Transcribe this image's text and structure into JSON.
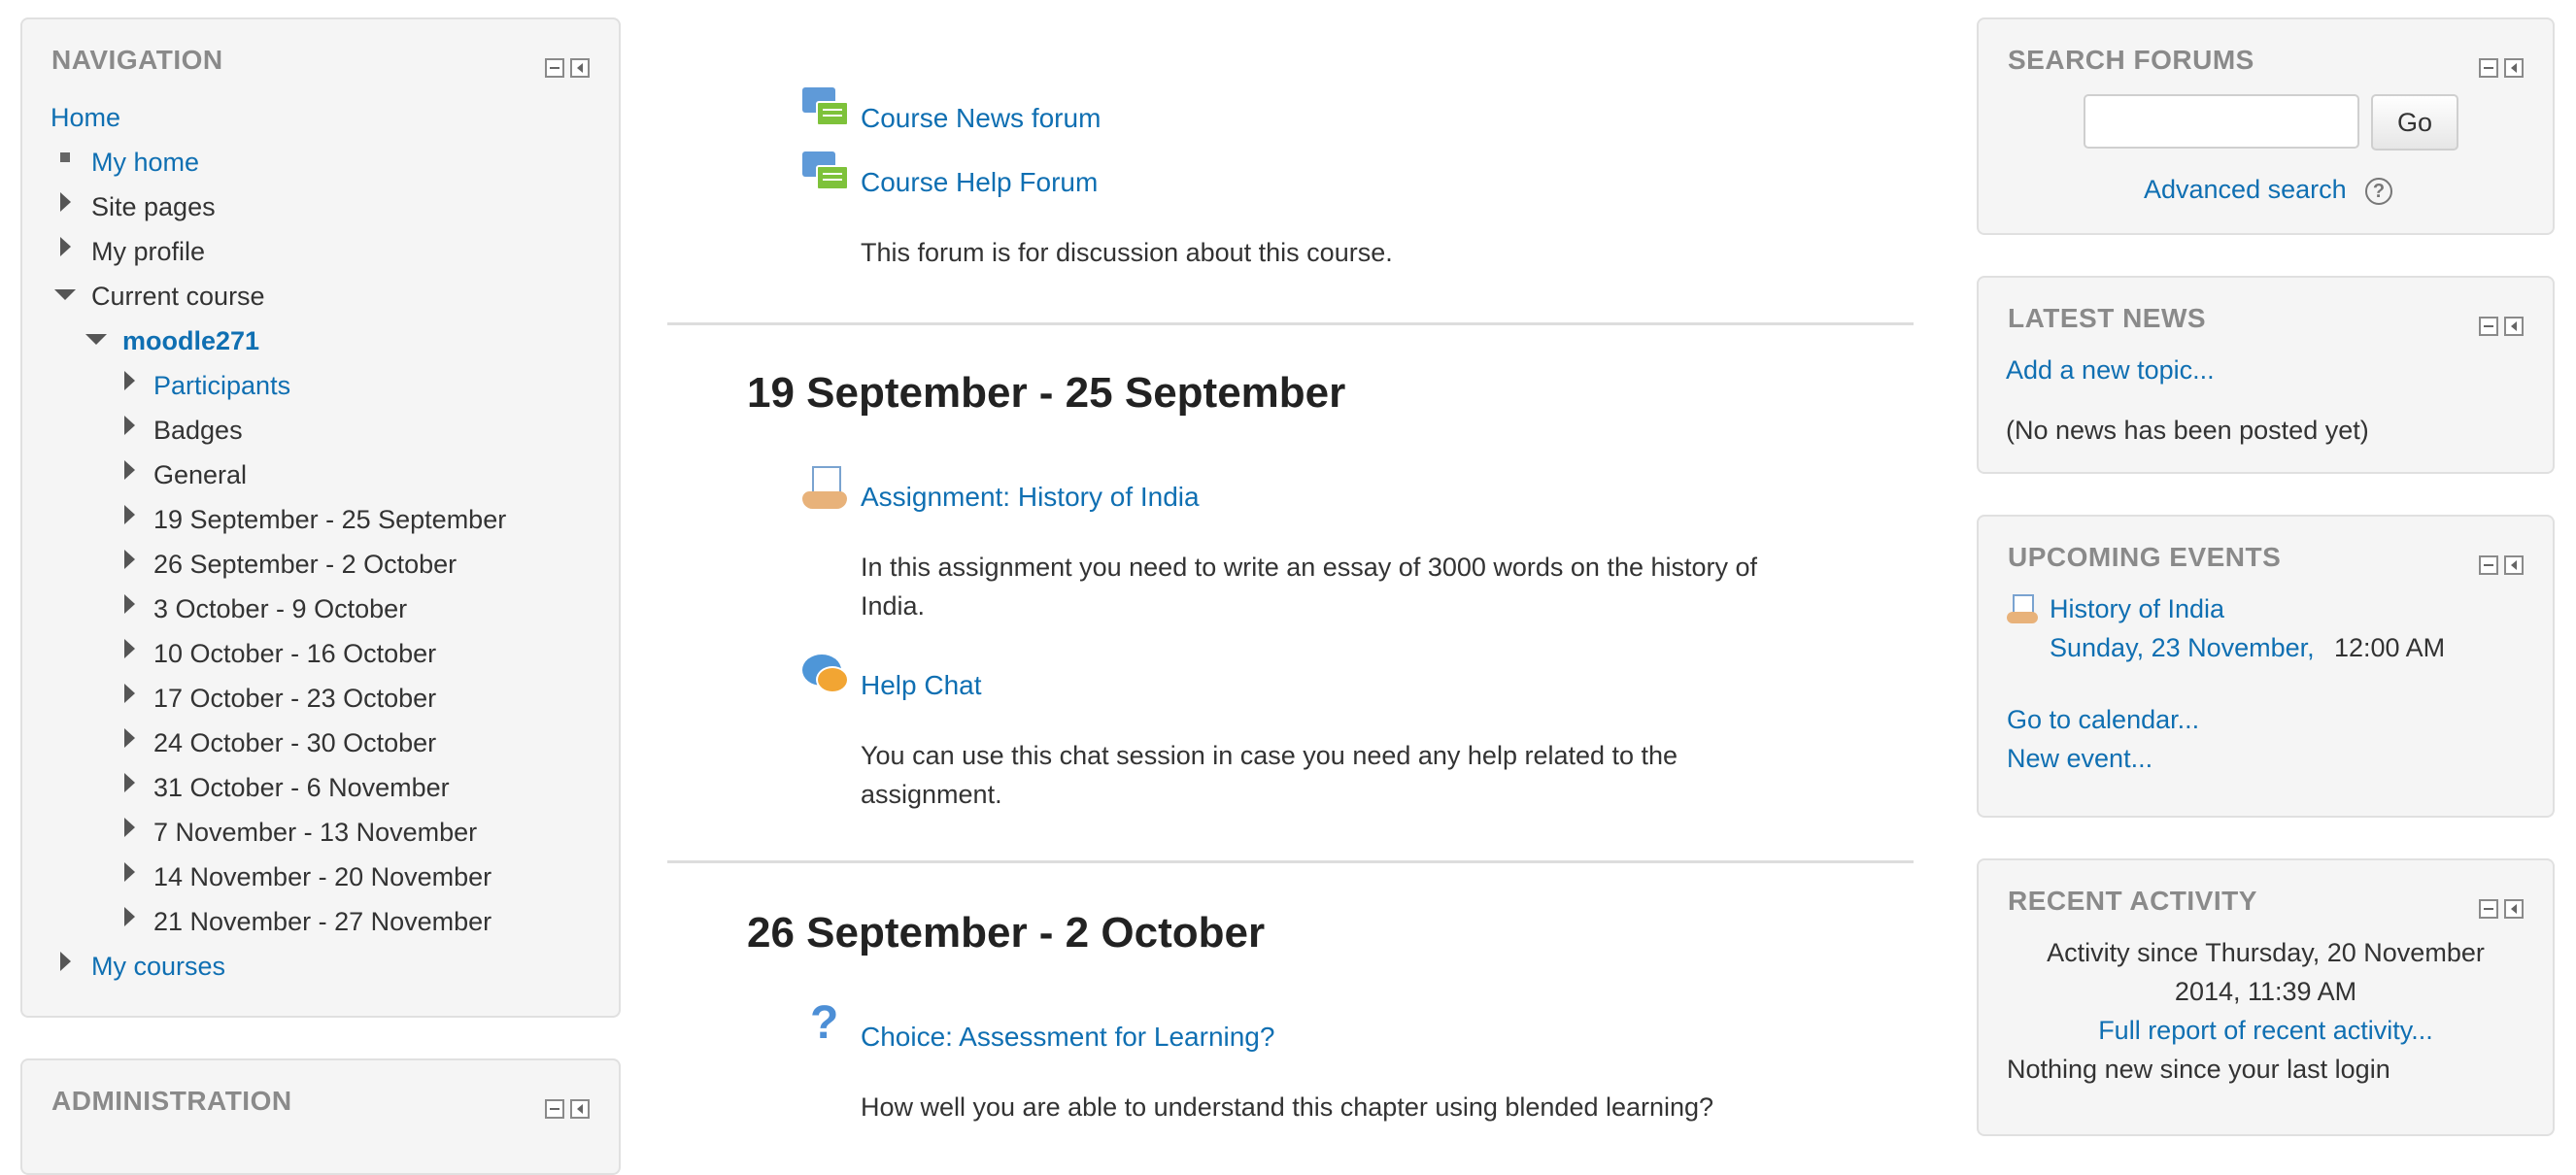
{
  "navigation": {
    "title": "NAVIGATION",
    "home": "Home",
    "my_home": "My home",
    "site_pages": "Site pages",
    "my_profile": "My profile",
    "current_course": "Current course",
    "course_name": "moodle271",
    "course_items": [
      "Participants",
      "Badges",
      "General",
      "19 September - 25 September",
      "26 September - 2 October",
      "3 October - 9 October",
      "10 October - 16 October",
      "17 October - 23 October",
      "24 October - 30 October",
      "31 October - 6 November",
      "7 November - 13 November",
      "14 November - 20 November",
      "21 November - 27 November"
    ],
    "my_courses": "My courses"
  },
  "administration": {
    "title": "ADMINISTRATION"
  },
  "main": {
    "forums": [
      {
        "label": "Course News forum"
      },
      {
        "label": "Course Help Forum",
        "description": "This forum is for discussion about this course."
      }
    ],
    "section1": {
      "title": "19 September - 25 September",
      "assignment_label": "Assignment: History of India",
      "assignment_desc_line1": "In this assignment you need to write an essay of 3000 words on the history of",
      "assignment_desc_line2": "India.",
      "chat_label": "Help Chat",
      "chat_desc_line1": "You can use this chat session in case you need any help related to the",
      "chat_desc_line2": "assignment."
    },
    "section2": {
      "title": "26 September - 2 October",
      "choice_label": "Choice: Assessment for Learning?",
      "choice_desc": "How well you are able to understand this chapter using blended learning?"
    }
  },
  "search_forums": {
    "title": "SEARCH FORUMS",
    "input_value": "",
    "go_label": "Go",
    "advanced": "Advanced search"
  },
  "latest_news": {
    "title": "LATEST NEWS",
    "add_topic": "Add a new topic...",
    "empty": "(No news has been posted yet)"
  },
  "upcoming_events": {
    "title": "UPCOMING EVENTS",
    "event_name": "History of India",
    "event_date_link": "Sunday, 23 November,",
    "event_time": "12:00 AM",
    "go_calendar": "Go to calendar...",
    "new_event": "New event..."
  },
  "recent_activity": {
    "title": "RECENT ACTIVITY",
    "since_line1": "Activity since Thursday, 20 November",
    "since_line2": "2014, 11:39 AM",
    "full_report": "Full report of recent activity...",
    "nothing_new": "Nothing new since your last login"
  }
}
